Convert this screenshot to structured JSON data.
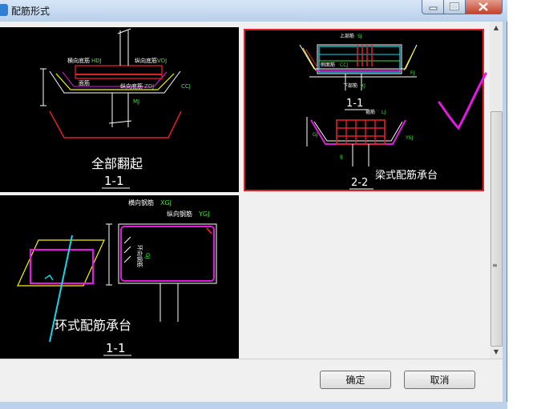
{
  "window": {
    "title": "配筋形式"
  },
  "options": [
    {
      "name": "全部翻起",
      "section": "1-1",
      "labels": {
        "horizontal": "横向底筋",
        "h_code": "HDJ",
        "vertical": "纵向底筋",
        "v_code": "VDJ",
        "v_code2": "ZDJ",
        "face": "面筋",
        "mj": "MJ",
        "cc": "CCJ"
      }
    },
    {
      "name": "梁式配筋承台",
      "section_a": "1-1",
      "section_b": "2-2",
      "labels": {
        "top": "上部筋",
        "sj": "SJ",
        "side": "侧面筋",
        "ccj": "CCJ",
        "bottom": "下部筋",
        "xj": "XJ",
        "stirrup": "箍筋",
        "gj": "GJ",
        "lj": "LJ",
        "ij": "IJ",
        "ysj": "YSJ",
        "fj": "FJ"
      }
    },
    {
      "name": "环式配筋承台",
      "section": "1-1",
      "labels": {
        "horizontal": "横向钢筋",
        "h_code": "XGJ",
        "vertical": "纵向钢筋",
        "v_code": "YGJ",
        "ring": "环向钢筋",
        "gj": "GJ"
      }
    }
  ],
  "buttons": {
    "ok": "确定",
    "cancel": "取消"
  },
  "colors": {
    "selection_border": "#e21f26",
    "checkmark": "#e01ae0",
    "rebar_red": "#e0202a",
    "rebar_yellow": "#f5f500",
    "rebar_magenta": "#e01ae0",
    "rebar_cyan": "#19d4e6",
    "label_green": "#3fe03f"
  }
}
